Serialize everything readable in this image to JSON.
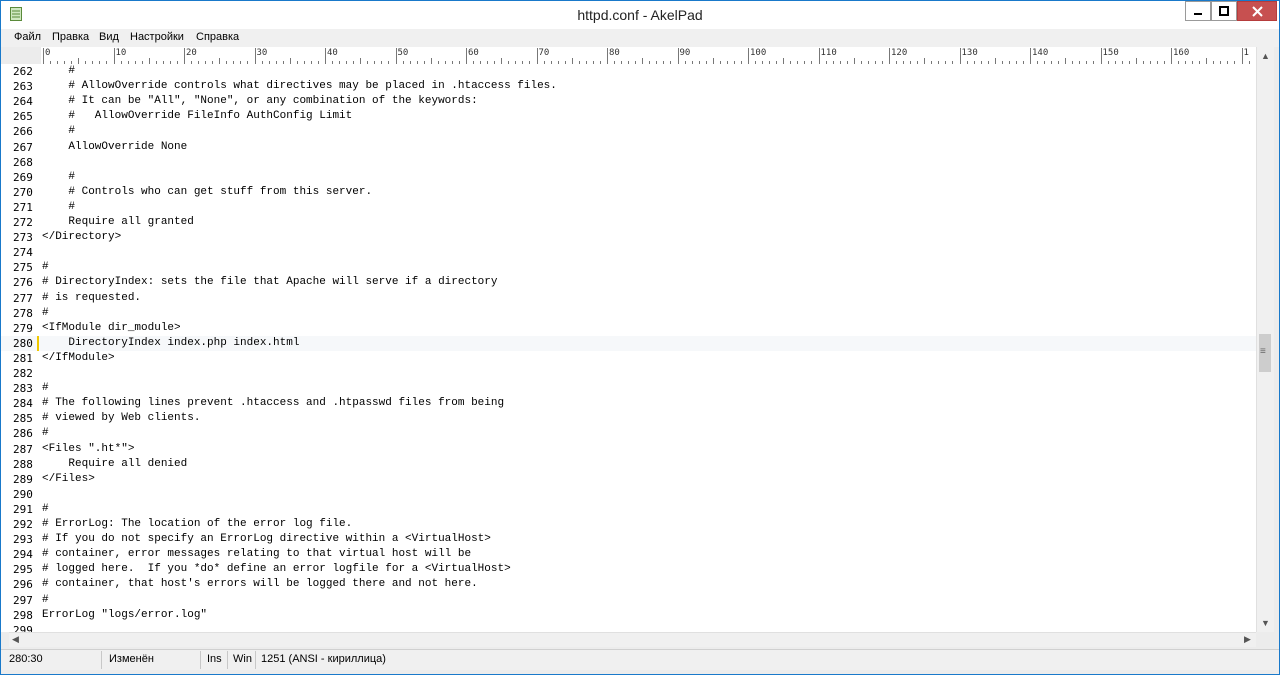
{
  "window": {
    "title": "httpd.conf - AkelPad"
  },
  "menu": [
    "Файл",
    "Правка",
    "Вид",
    "Настройки",
    "Справка"
  ],
  "ruler": {
    "labels": [
      "0",
      "10",
      "20",
      "30",
      "40",
      "50",
      "60",
      "70",
      "80",
      "90",
      "100",
      "110",
      "120",
      "130",
      "140",
      "150",
      "160",
      "1"
    ]
  },
  "editor": {
    "current_line": 280,
    "lines": [
      {
        "n": "262",
        "t": "    #"
      },
      {
        "n": "263",
        "t": "    # AllowOverride controls what directives may be placed in .htaccess files."
      },
      {
        "n": "264",
        "t": "    # It can be \"All\", \"None\", or any combination of the keywords:"
      },
      {
        "n": "265",
        "t": "    #   AllowOverride FileInfo AuthConfig Limit"
      },
      {
        "n": "266",
        "t": "    #"
      },
      {
        "n": "267",
        "t": "    AllowOverride None"
      },
      {
        "n": "268",
        "t": ""
      },
      {
        "n": "269",
        "t": "    #"
      },
      {
        "n": "270",
        "t": "    # Controls who can get stuff from this server."
      },
      {
        "n": "271",
        "t": "    #"
      },
      {
        "n": "272",
        "t": "    Require all granted"
      },
      {
        "n": "273",
        "t": "</Directory>"
      },
      {
        "n": "274",
        "t": ""
      },
      {
        "n": "275",
        "t": "#"
      },
      {
        "n": "276",
        "t": "# DirectoryIndex: sets the file that Apache will serve if a directory"
      },
      {
        "n": "277",
        "t": "# is requested."
      },
      {
        "n": "278",
        "t": "#"
      },
      {
        "n": "279",
        "t": "<IfModule dir_module>"
      },
      {
        "n": "280",
        "t": "    DirectoryIndex index.php index.html"
      },
      {
        "n": "281",
        "t": "</IfModule>"
      },
      {
        "n": "282",
        "t": ""
      },
      {
        "n": "283",
        "t": "#"
      },
      {
        "n": "284",
        "t": "# The following lines prevent .htaccess and .htpasswd files from being"
      },
      {
        "n": "285",
        "t": "# viewed by Web clients."
      },
      {
        "n": "286",
        "t": "#"
      },
      {
        "n": "287",
        "t": "<Files \".ht*\">"
      },
      {
        "n": "288",
        "t": "    Require all denied"
      },
      {
        "n": "289",
        "t": "</Files>"
      },
      {
        "n": "290",
        "t": ""
      },
      {
        "n": "291",
        "t": "#"
      },
      {
        "n": "292",
        "t": "# ErrorLog: The location of the error log file."
      },
      {
        "n": "293",
        "t": "# If you do not specify an ErrorLog directive within a <VirtualHost>"
      },
      {
        "n": "294",
        "t": "# container, error messages relating to that virtual host will be"
      },
      {
        "n": "295",
        "t": "# logged here.  If you *do* define an error logfile for a <VirtualHost>"
      },
      {
        "n": "296",
        "t": "# container, that host's errors will be logged there and not here."
      },
      {
        "n": "297",
        "t": "#"
      },
      {
        "n": "298",
        "t": "ErrorLog \"logs/error.log\""
      },
      {
        "n": "299",
        "t": ""
      }
    ]
  },
  "status": {
    "position": "280:30",
    "modified": "Изменён",
    "insert_mode": "Ins",
    "newline": "Win",
    "encoding": "1251  (ANSI - кириллица)"
  },
  "colors": {
    "frame": "#1979ca",
    "close_button": "#c75050",
    "current_line_marker": "#f0c800"
  }
}
